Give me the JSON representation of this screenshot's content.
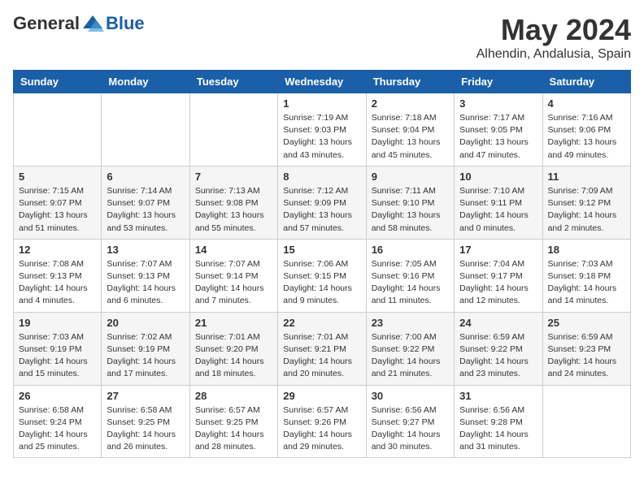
{
  "header": {
    "logo_general": "General",
    "logo_blue": "Blue",
    "month_year": "May 2024",
    "location": "Alhendin, Andalusia, Spain"
  },
  "weekdays": [
    "Sunday",
    "Monday",
    "Tuesday",
    "Wednesday",
    "Thursday",
    "Friday",
    "Saturday"
  ],
  "weeks": [
    [
      {
        "day": "",
        "sunrise": "",
        "sunset": "",
        "daylight": ""
      },
      {
        "day": "",
        "sunrise": "",
        "sunset": "",
        "daylight": ""
      },
      {
        "day": "",
        "sunrise": "",
        "sunset": "",
        "daylight": ""
      },
      {
        "day": "1",
        "sunrise": "Sunrise: 7:19 AM",
        "sunset": "Sunset: 9:03 PM",
        "daylight": "Daylight: 13 hours and 43 minutes."
      },
      {
        "day": "2",
        "sunrise": "Sunrise: 7:18 AM",
        "sunset": "Sunset: 9:04 PM",
        "daylight": "Daylight: 13 hours and 45 minutes."
      },
      {
        "day": "3",
        "sunrise": "Sunrise: 7:17 AM",
        "sunset": "Sunset: 9:05 PM",
        "daylight": "Daylight: 13 hours and 47 minutes."
      },
      {
        "day": "4",
        "sunrise": "Sunrise: 7:16 AM",
        "sunset": "Sunset: 9:06 PM",
        "daylight": "Daylight: 13 hours and 49 minutes."
      }
    ],
    [
      {
        "day": "5",
        "sunrise": "Sunrise: 7:15 AM",
        "sunset": "Sunset: 9:07 PM",
        "daylight": "Daylight: 13 hours and 51 minutes."
      },
      {
        "day": "6",
        "sunrise": "Sunrise: 7:14 AM",
        "sunset": "Sunset: 9:07 PM",
        "daylight": "Daylight: 13 hours and 53 minutes."
      },
      {
        "day": "7",
        "sunrise": "Sunrise: 7:13 AM",
        "sunset": "Sunset: 9:08 PM",
        "daylight": "Daylight: 13 hours and 55 minutes."
      },
      {
        "day": "8",
        "sunrise": "Sunrise: 7:12 AM",
        "sunset": "Sunset: 9:09 PM",
        "daylight": "Daylight: 13 hours and 57 minutes."
      },
      {
        "day": "9",
        "sunrise": "Sunrise: 7:11 AM",
        "sunset": "Sunset: 9:10 PM",
        "daylight": "Daylight: 13 hours and 58 minutes."
      },
      {
        "day": "10",
        "sunrise": "Sunrise: 7:10 AM",
        "sunset": "Sunset: 9:11 PM",
        "daylight": "Daylight: 14 hours and 0 minutes."
      },
      {
        "day": "11",
        "sunrise": "Sunrise: 7:09 AM",
        "sunset": "Sunset: 9:12 PM",
        "daylight": "Daylight: 14 hours and 2 minutes."
      }
    ],
    [
      {
        "day": "12",
        "sunrise": "Sunrise: 7:08 AM",
        "sunset": "Sunset: 9:13 PM",
        "daylight": "Daylight: 14 hours and 4 minutes."
      },
      {
        "day": "13",
        "sunrise": "Sunrise: 7:07 AM",
        "sunset": "Sunset: 9:13 PM",
        "daylight": "Daylight: 14 hours and 6 minutes."
      },
      {
        "day": "14",
        "sunrise": "Sunrise: 7:07 AM",
        "sunset": "Sunset: 9:14 PM",
        "daylight": "Daylight: 14 hours and 7 minutes."
      },
      {
        "day": "15",
        "sunrise": "Sunrise: 7:06 AM",
        "sunset": "Sunset: 9:15 PM",
        "daylight": "Daylight: 14 hours and 9 minutes."
      },
      {
        "day": "16",
        "sunrise": "Sunrise: 7:05 AM",
        "sunset": "Sunset: 9:16 PM",
        "daylight": "Daylight: 14 hours and 11 minutes."
      },
      {
        "day": "17",
        "sunrise": "Sunrise: 7:04 AM",
        "sunset": "Sunset: 9:17 PM",
        "daylight": "Daylight: 14 hours and 12 minutes."
      },
      {
        "day": "18",
        "sunrise": "Sunrise: 7:03 AM",
        "sunset": "Sunset: 9:18 PM",
        "daylight": "Daylight: 14 hours and 14 minutes."
      }
    ],
    [
      {
        "day": "19",
        "sunrise": "Sunrise: 7:03 AM",
        "sunset": "Sunset: 9:19 PM",
        "daylight": "Daylight: 14 hours and 15 minutes."
      },
      {
        "day": "20",
        "sunrise": "Sunrise: 7:02 AM",
        "sunset": "Sunset: 9:19 PM",
        "daylight": "Daylight: 14 hours and 17 minutes."
      },
      {
        "day": "21",
        "sunrise": "Sunrise: 7:01 AM",
        "sunset": "Sunset: 9:20 PM",
        "daylight": "Daylight: 14 hours and 18 minutes."
      },
      {
        "day": "22",
        "sunrise": "Sunrise: 7:01 AM",
        "sunset": "Sunset: 9:21 PM",
        "daylight": "Daylight: 14 hours and 20 minutes."
      },
      {
        "day": "23",
        "sunrise": "Sunrise: 7:00 AM",
        "sunset": "Sunset: 9:22 PM",
        "daylight": "Daylight: 14 hours and 21 minutes."
      },
      {
        "day": "24",
        "sunrise": "Sunrise: 6:59 AM",
        "sunset": "Sunset: 9:22 PM",
        "daylight": "Daylight: 14 hours and 23 minutes."
      },
      {
        "day": "25",
        "sunrise": "Sunrise: 6:59 AM",
        "sunset": "Sunset: 9:23 PM",
        "daylight": "Daylight: 14 hours and 24 minutes."
      }
    ],
    [
      {
        "day": "26",
        "sunrise": "Sunrise: 6:58 AM",
        "sunset": "Sunset: 9:24 PM",
        "daylight": "Daylight: 14 hours and 25 minutes."
      },
      {
        "day": "27",
        "sunrise": "Sunrise: 6:58 AM",
        "sunset": "Sunset: 9:25 PM",
        "daylight": "Daylight: 14 hours and 26 minutes."
      },
      {
        "day": "28",
        "sunrise": "Sunrise: 6:57 AM",
        "sunset": "Sunset: 9:25 PM",
        "daylight": "Daylight: 14 hours and 28 minutes."
      },
      {
        "day": "29",
        "sunrise": "Sunrise: 6:57 AM",
        "sunset": "Sunset: 9:26 PM",
        "daylight": "Daylight: 14 hours and 29 minutes."
      },
      {
        "day": "30",
        "sunrise": "Sunrise: 6:56 AM",
        "sunset": "Sunset: 9:27 PM",
        "daylight": "Daylight: 14 hours and 30 minutes."
      },
      {
        "day": "31",
        "sunrise": "Sunrise: 6:56 AM",
        "sunset": "Sunset: 9:28 PM",
        "daylight": "Daylight: 14 hours and 31 minutes."
      },
      {
        "day": "",
        "sunrise": "",
        "sunset": "",
        "daylight": ""
      }
    ]
  ]
}
